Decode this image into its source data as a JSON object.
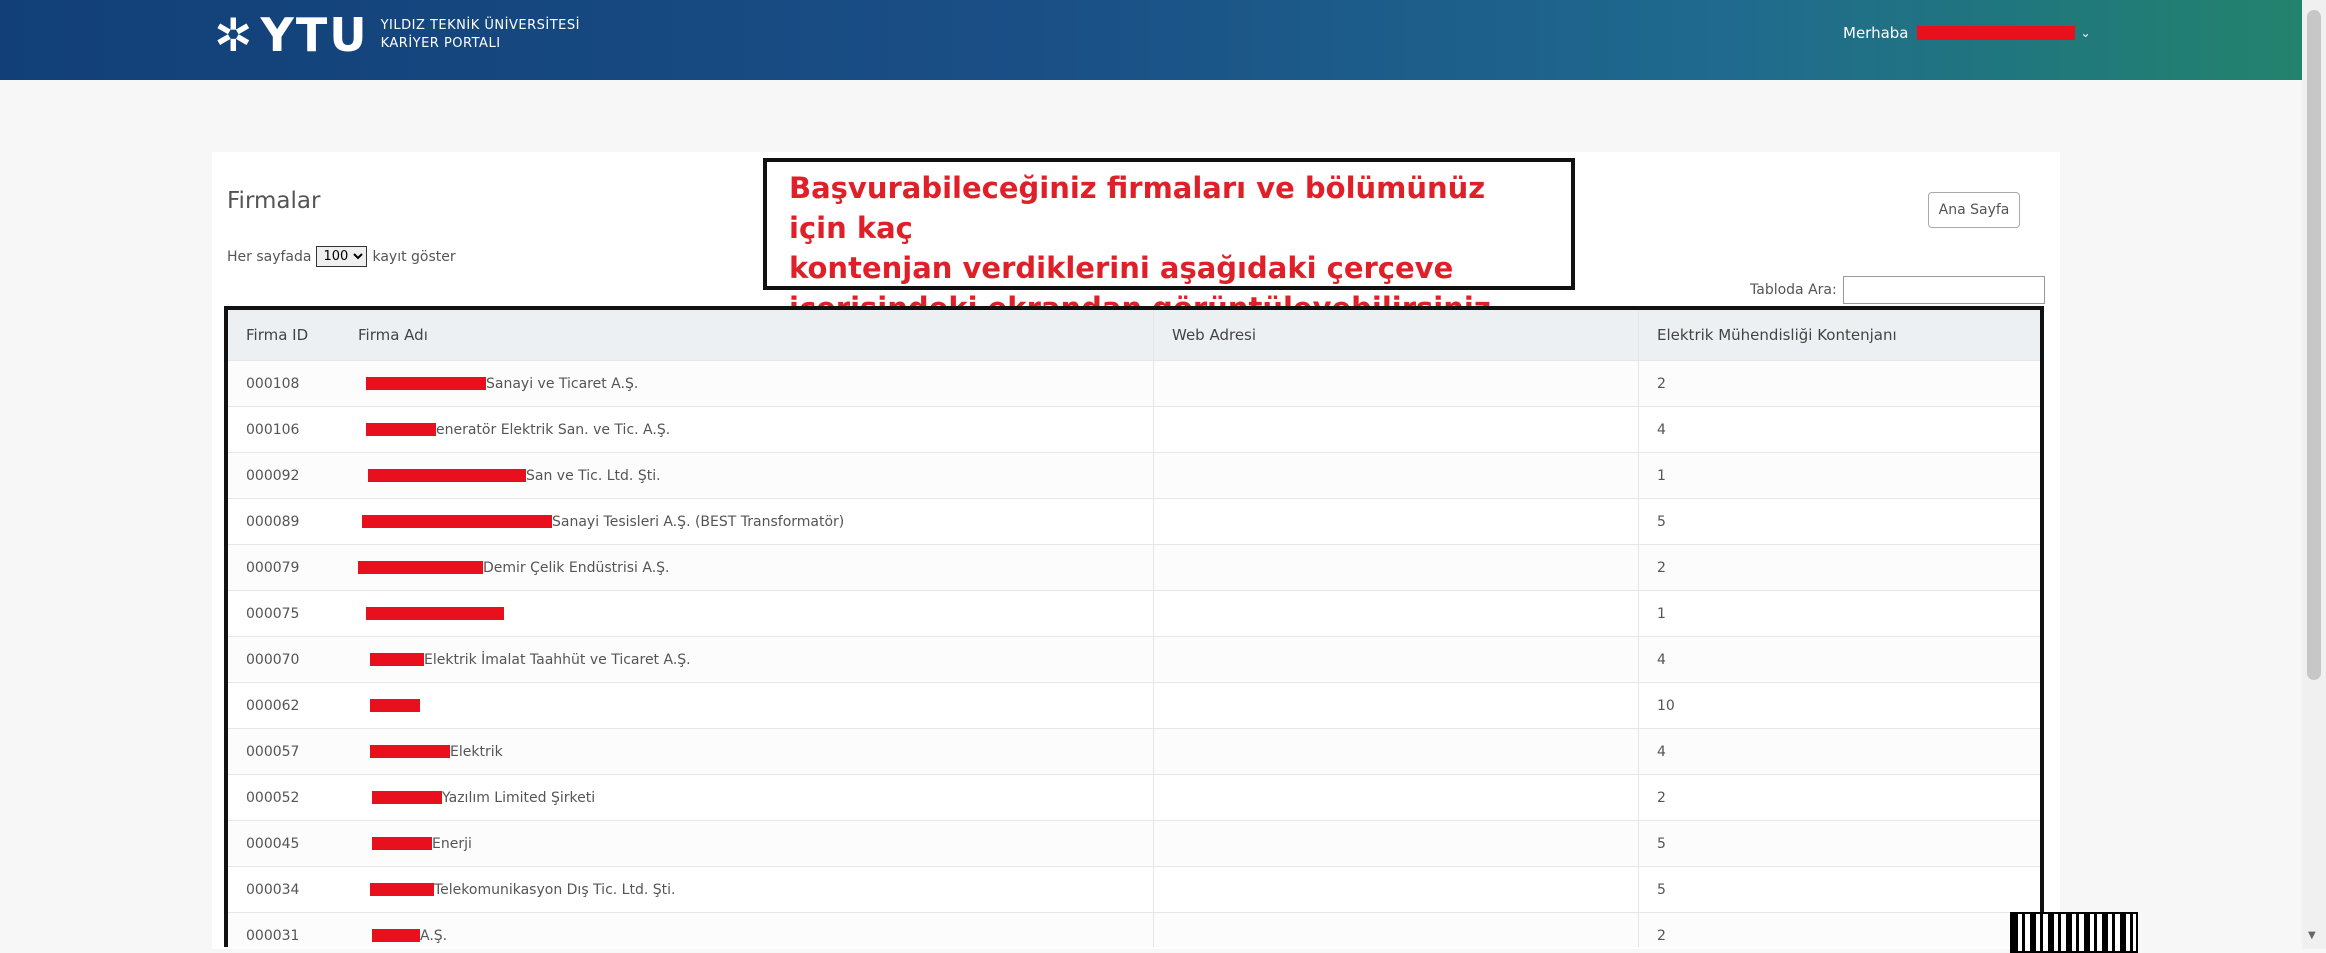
{
  "header": {
    "logo_star": "✲",
    "logo_letters": "YTU",
    "logo_line1": "YILDIZ TEKNİK ÜNİVERSİTESİ",
    "logo_line2": "KARİYER PORTALI",
    "greeting": "Merhaba",
    "chevron": "⌄"
  },
  "page": {
    "title": "Firmalar",
    "per_page_before": "Her sayfada",
    "per_page_value": "100",
    "per_page_after": "kayıt göster",
    "home_button": "Ana Sayfa",
    "search_label": "Tabloda Ara:",
    "search_value": ""
  },
  "annotation": {
    "line1": "Başvurabileceğiniz firmaları ve bölümünüz için kaç",
    "line2": "kontenjan verdiklerini aşağıdaki çerçeve",
    "line3": "içerisindeki ekrandan görüntüleyebilirsiniz."
  },
  "table": {
    "headers": [
      "Firma ID",
      "Firma Adı",
      "Web Adresi",
      "Elektrik Mühendisliği Kontenjanı"
    ],
    "rows": [
      {
        "id": "000108",
        "name": "Sanayi ve Ticaret A.Ş.",
        "web": "",
        "kontenjan": "2"
      },
      {
        "id": "000106",
        "name": "eneratör Elektrik San. ve Tic. A.Ş.",
        "web": "",
        "kontenjan": "4"
      },
      {
        "id": "000092",
        "name": "San ve Tic. Ltd. Şti.",
        "web": "",
        "kontenjan": "1"
      },
      {
        "id": "000089",
        "name": "Sanayi Tesisleri A.Ş. (BEST Transformatör)",
        "web": "",
        "kontenjan": "5"
      },
      {
        "id": "000079",
        "name": "Demir Çelik Endüstrisi A.Ş.",
        "web": "",
        "kontenjan": "2"
      },
      {
        "id": "000075",
        "name": "",
        "web": "",
        "kontenjan": "1"
      },
      {
        "id": "000070",
        "name": "Elektrik İmalat Taahhüt ve Ticaret A.Ş.",
        "web": "",
        "kontenjan": "4"
      },
      {
        "id": "000062",
        "name": "",
        "web": "",
        "kontenjan": "10"
      },
      {
        "id": "000057",
        "name": "Elektrik",
        "web": "",
        "kontenjan": "4"
      },
      {
        "id": "000052",
        "name": "Yazılım Limited Şirketi",
        "web": "",
        "kontenjan": "2"
      },
      {
        "id": "000045",
        "name": "Enerji",
        "web": "",
        "kontenjan": "5"
      },
      {
        "id": "000034",
        "name": "Telekomunikasyon Dış Tic. Ltd. Şti.",
        "web": "",
        "kontenjan": "5"
      },
      {
        "id": "000031",
        "name": "A.Ş.",
        "web": "",
        "kontenjan": "2"
      }
    ]
  },
  "colors": {
    "redaction": "#e8101c",
    "annotation_text": "#e02028"
  }
}
